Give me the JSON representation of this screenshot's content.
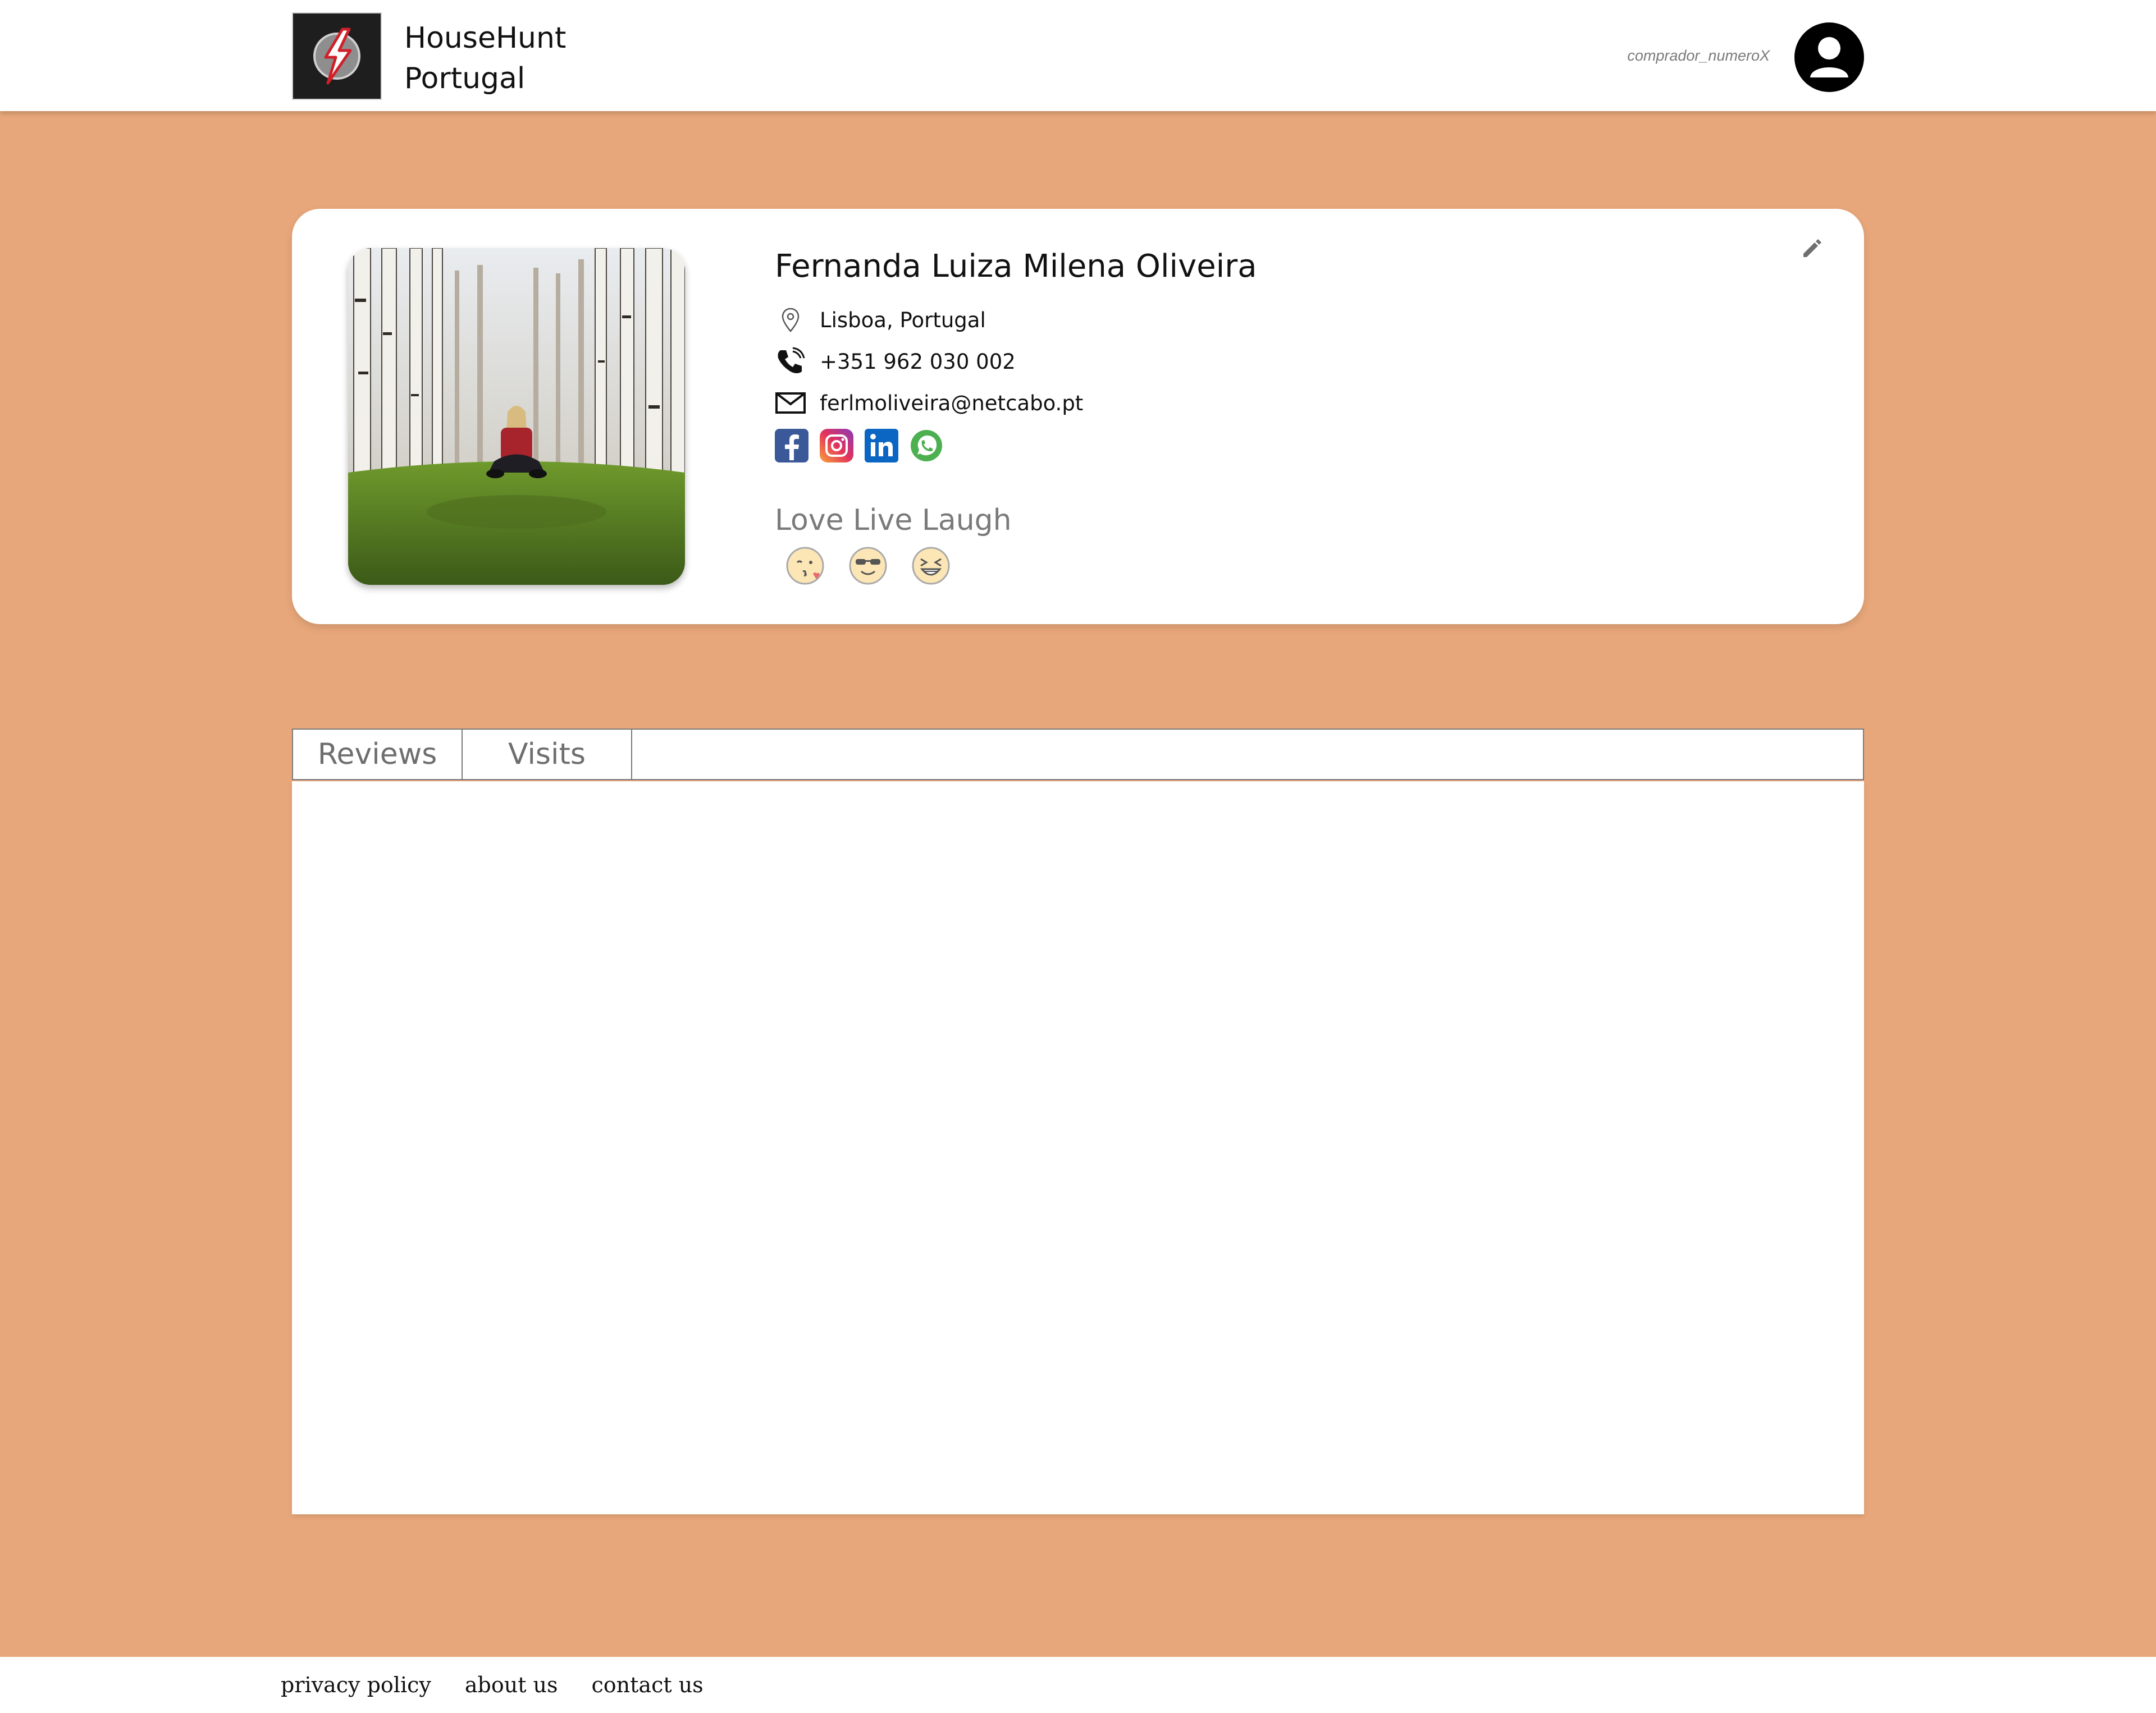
{
  "header": {
    "brand_line1": "HouseHunt",
    "brand_line2": "Portugal",
    "username": "comprador_numeroX"
  },
  "profile": {
    "name": "Fernanda Luiza Milena Oliveira",
    "location": "Lisboa, Portugal",
    "phone": "+351 962 030 002",
    "email": "ferlmoliveira@netcabo.pt",
    "motto": "Love Live Laugh",
    "socials": [
      "facebook-icon",
      "instagram-icon",
      "linkedin-icon",
      "whatsapp-icon"
    ],
    "emojis": [
      "kissing-emoji",
      "sunglasses-emoji",
      "laughing-emoji"
    ]
  },
  "tabs": [
    {
      "label": "Reviews"
    },
    {
      "label": "Visits"
    }
  ],
  "footer": {
    "links": [
      {
        "label": "privacy policy"
      },
      {
        "label": "about us"
      },
      {
        "label": "contact us"
      }
    ]
  },
  "colors": {
    "background": "#e8a77a",
    "surface": "#ffffff",
    "text": "#111111",
    "muted": "#7a7a7a"
  }
}
